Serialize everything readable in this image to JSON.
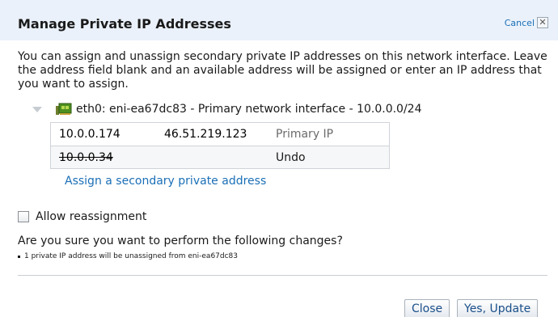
{
  "dialog": {
    "title": "Manage Private IP Addresses",
    "cancel_label": "Cancel",
    "close_glyph": "✕",
    "intro": "You can assign and unassign secondary private IP addresses on this network interface. Leave the address field blank and an available address will be assigned or enter an IP address that you want to assign."
  },
  "interface": {
    "label": "eth0: eni-ea67dc83 - Primary network interface - 10.0.0.0/24",
    "icon": "network-card-icon",
    "expander_icon": "expand-triangle-icon"
  },
  "ip_table": {
    "rows": [
      {
        "private_ip": "10.0.0.174",
        "public_ip": "46.51.219.123",
        "status": "Primary IP"
      },
      {
        "private_ip": "10.0.0.34",
        "public_ip": "",
        "action": "Undo"
      }
    ]
  },
  "assign_link": "Assign a secondary private address",
  "reassignment": {
    "label": "Allow reassignment",
    "checked": false
  },
  "confirm": {
    "question": "Are you sure you want to perform the following changes?",
    "changes": [
      "1 private IP address will be unassigned from eni-ea67dc83"
    ]
  },
  "buttons": {
    "close": "Close",
    "update": "Yes, Update"
  },
  "colors": {
    "header_bg": "#eaf1fa",
    "link": "#1a6fb7",
    "button_text": "#1a4f8a",
    "border": "#cfd4d9"
  }
}
